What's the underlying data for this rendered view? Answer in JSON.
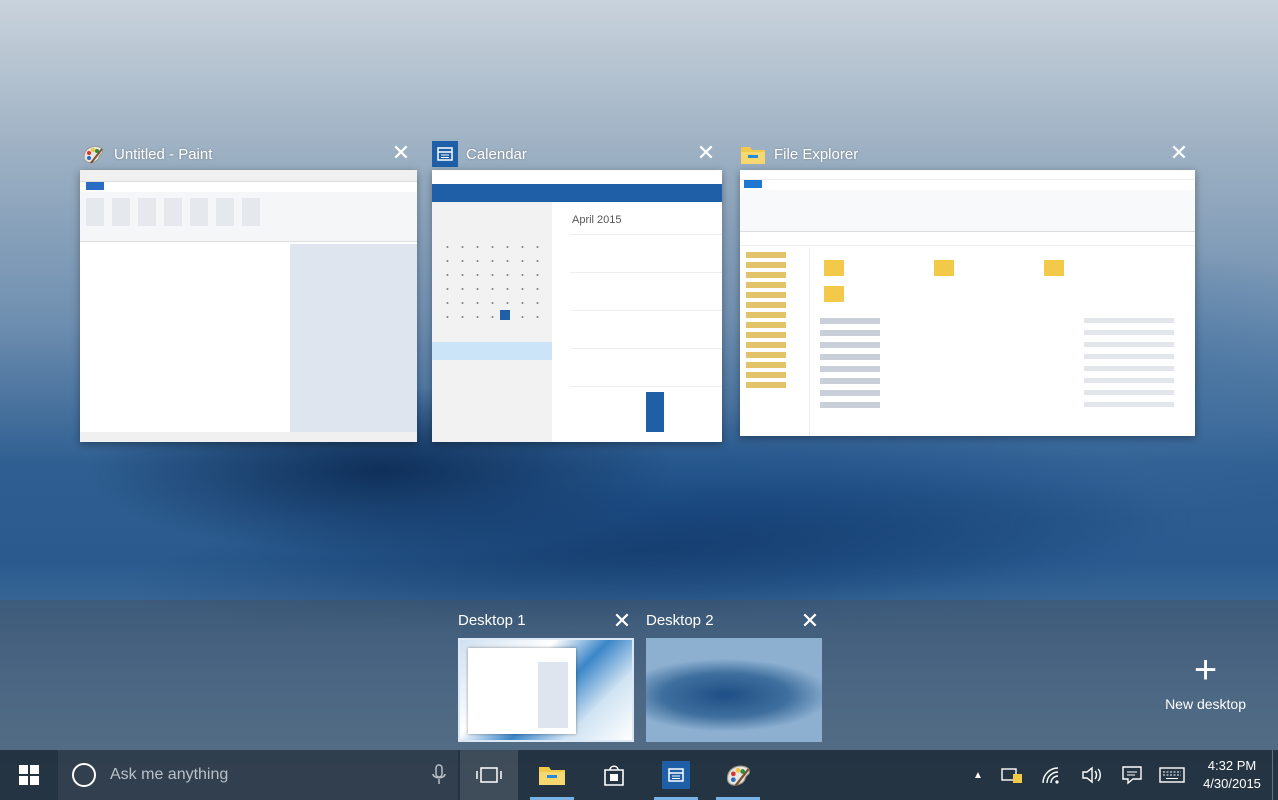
{
  "windows": [
    {
      "title": "Untitled - Paint",
      "icon": "paint-icon"
    },
    {
      "title": "Calendar",
      "icon": "calendar-icon"
    },
    {
      "title": "File Explorer",
      "icon": "folder-icon"
    }
  ],
  "calendar_thumb": {
    "month": "April 2015"
  },
  "desktops": [
    {
      "label": "Desktop 1"
    },
    {
      "label": "Desktop 2"
    }
  ],
  "new_desktop": {
    "label": "New desktop",
    "icon": "plus-icon"
  },
  "taskbar": {
    "search_placeholder": "Ask me anything",
    "apps": [
      "file-explorer-icon",
      "store-icon",
      "calendar-icon",
      "paint-icon"
    ],
    "clock": {
      "time": "4:32 PM",
      "date": "4/30/2015"
    }
  },
  "colors": {
    "accent": "#1e5fa8",
    "taskbar": "#202c3a"
  }
}
